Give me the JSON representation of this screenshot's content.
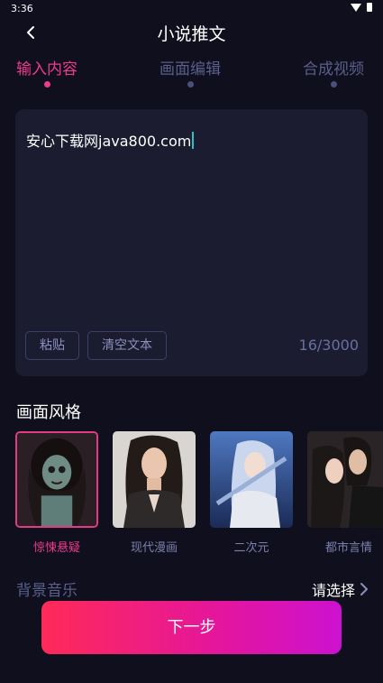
{
  "status_bar": {
    "time": "3:36"
  },
  "header": {
    "title": "小说推文"
  },
  "steps": [
    {
      "label": "输入内容",
      "active": true
    },
    {
      "label": "画面编辑",
      "active": false
    },
    {
      "label": "合成视频",
      "active": false
    }
  ],
  "editor": {
    "text": "安心下载网java800.com",
    "paste_label": "粘贴",
    "clear_label": "清空文本",
    "counter": "16/3000"
  },
  "style_section": {
    "title": "画面风格",
    "items": [
      {
        "label": "惊悚悬疑",
        "selected": true
      },
      {
        "label": "现代漫画",
        "selected": false
      },
      {
        "label": "二次元",
        "selected": false
      },
      {
        "label": "都市言情",
        "selected": false
      }
    ]
  },
  "music": {
    "label": "背景音乐",
    "value": "请选择"
  },
  "next_button": {
    "label": "下一步"
  },
  "colors": {
    "accent": "#ee3a8f",
    "background": "#0f0f1d",
    "card": "#1c1c31",
    "gradient_start": "#fe2a58",
    "gradient_end": "#cc12d0"
  }
}
